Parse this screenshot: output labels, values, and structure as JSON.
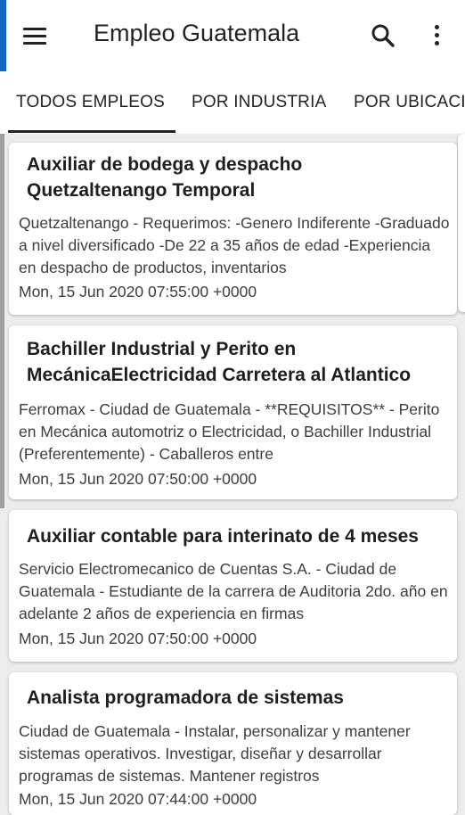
{
  "app": {
    "title": "Empleo Guatemala",
    "accent": "#1565c0"
  },
  "toolbar": {
    "menu_icon": "hamburger-menu-icon",
    "search_icon": "search-icon",
    "more_icon": "more-vert-icon"
  },
  "tabs": [
    {
      "label": "TODOS EMPLEOS",
      "selected": true
    },
    {
      "label": "POR INDUSTRIA",
      "selected": false
    },
    {
      "label": "POR UBICACIÓN",
      "selected": false
    }
  ],
  "jobs": [
    {
      "title": "Auxiliar de bodega y despacho Quetzaltenango Temporal",
      "description": "Quetzaltenango - Requerimos: -Genero Indiferente -Graduado a nivel diversificado -De 22 a 35 años de edad -Experiencia en despacho de productos, inventarios",
      "date": "Mon, 15 Jun 2020 07:55:00 +0000"
    },
    {
      "title": "Bachiller Industrial y Perito en MecánicaElectricidad Carretera al Atlantico",
      "description": "Ferromax - Ciudad de Guatemala - **REQUISITOS** - Perito en Mecánica automotriz o Electricidad, o Bachiller Industrial (Preferentemente) - Caballeros entre",
      "date": "Mon, 15 Jun 2020 07:50:00 +0000"
    },
    {
      "title": "Auxiliar contable para interinato de 4 meses",
      "description": "Servicio Electromecanico de Cuentas S.A. - Ciudad de Guatemala - Estudiante de la carrera de Auditoria 2do. año en adelante 2 años de experiencia en firmas",
      "date": "Mon, 15 Jun 2020 07:50:00 +0000"
    },
    {
      "title": "Analista programadora de sistemas",
      "description": "Ciudad de Guatemala - Instalar, personalizar y mantener sistemas operativos. Investigar, diseñar y desarrollar programas de sistemas. Mantener registros",
      "date": "Mon, 15 Jun 2020 07:44:00 +0000"
    }
  ]
}
